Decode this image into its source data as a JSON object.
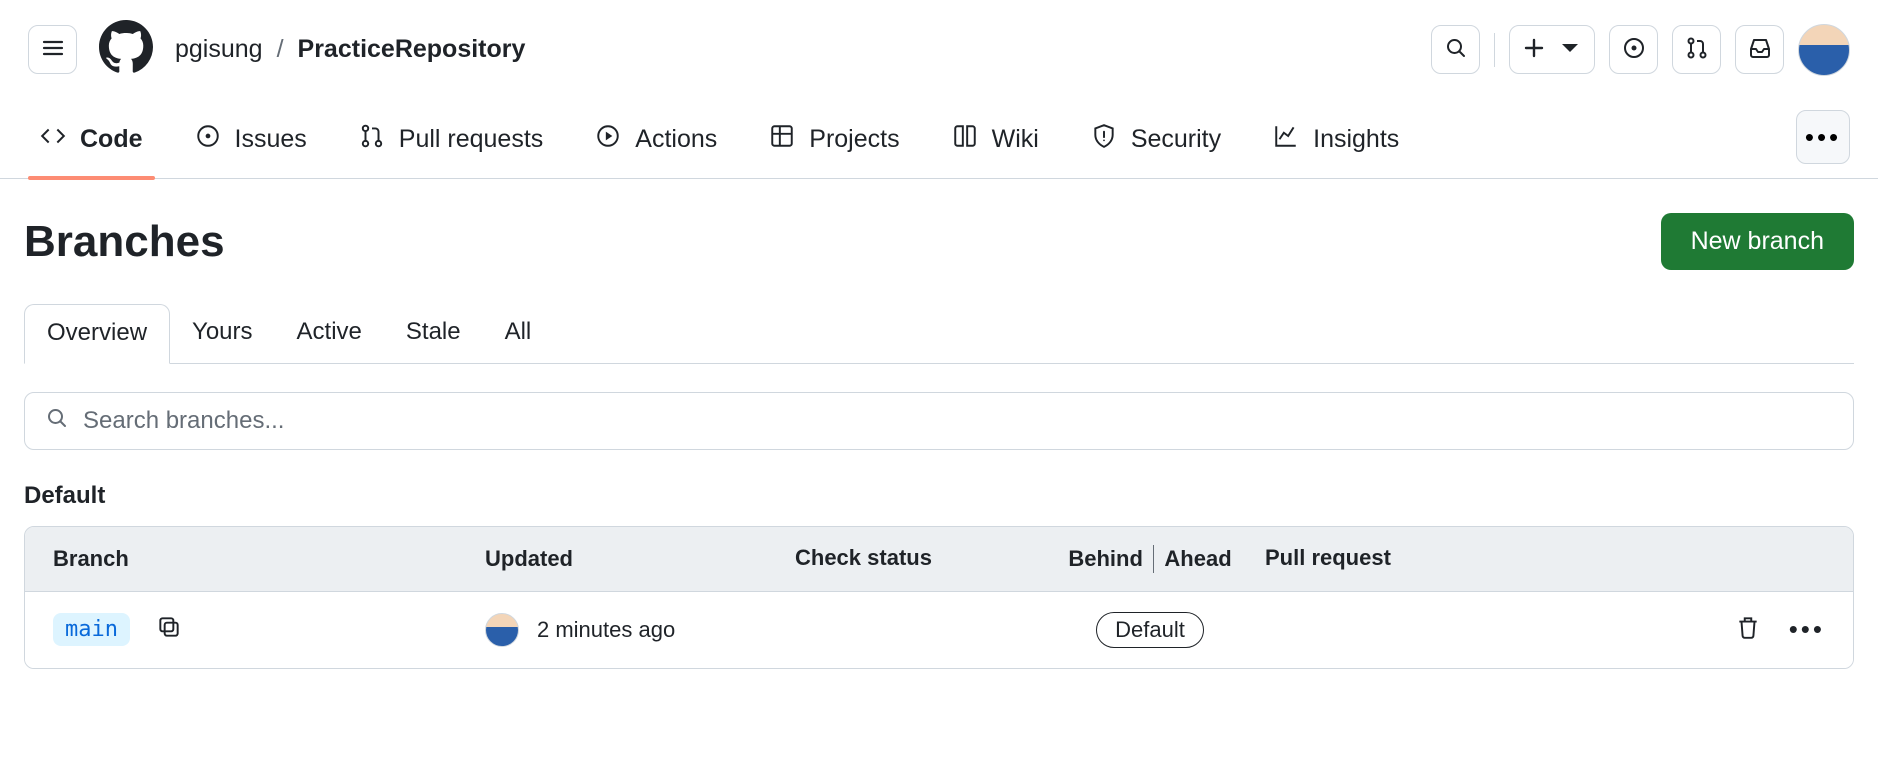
{
  "header": {
    "owner": "pgisung",
    "separator": "/",
    "repo": "PracticeRepository"
  },
  "repo_nav": {
    "code": "Code",
    "issues": "Issues",
    "pulls": "Pull requests",
    "actions": "Actions",
    "projects": "Projects",
    "wiki": "Wiki",
    "security": "Security",
    "insights": "Insights"
  },
  "page": {
    "title": "Branches",
    "new_branch": "New branch",
    "tabs": {
      "overview": "Overview",
      "yours": "Yours",
      "active": "Active",
      "stale": "Stale",
      "all": "All"
    },
    "search_placeholder": "Search branches...",
    "section_default": "Default"
  },
  "table": {
    "headers": {
      "branch": "Branch",
      "updated": "Updated",
      "check": "Check status",
      "behind": "Behind",
      "ahead": "Ahead",
      "pr": "Pull request"
    },
    "rows": [
      {
        "name": "main",
        "updated": "2 minutes ago",
        "badge": "Default"
      }
    ]
  }
}
